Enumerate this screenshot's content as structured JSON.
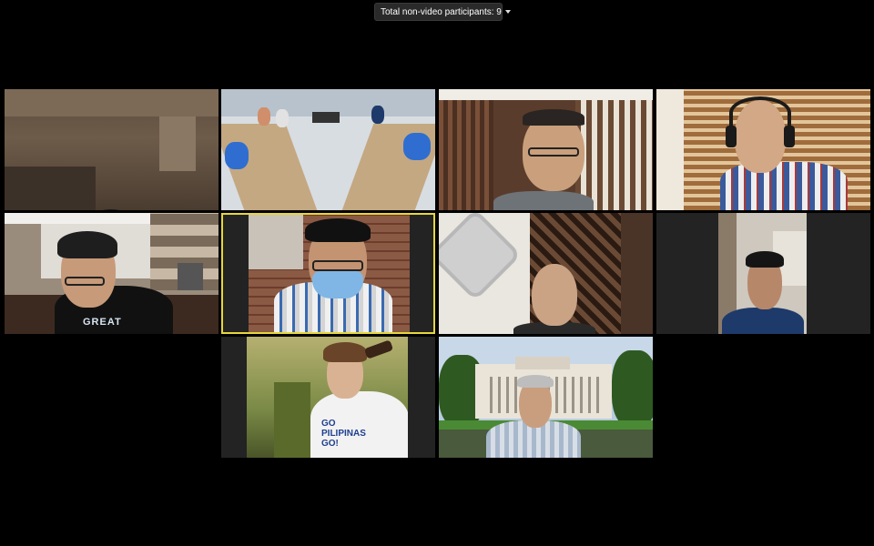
{
  "toolbar": {
    "participants_label": "Total non-video participants: 9"
  },
  "tiles": [
    {
      "id": "tile-1",
      "active": false,
      "shirt_text": ""
    },
    {
      "id": "tile-2",
      "active": false,
      "shirt_text": ""
    },
    {
      "id": "tile-3",
      "active": false,
      "shirt_text": ""
    },
    {
      "id": "tile-4",
      "active": false,
      "shirt_text": ""
    },
    {
      "id": "tile-5",
      "active": false,
      "shirt_text": "GREAT"
    },
    {
      "id": "tile-6",
      "active": true,
      "shirt_text": ""
    },
    {
      "id": "tile-7",
      "active": false,
      "shirt_text": ""
    },
    {
      "id": "tile-8",
      "active": false,
      "shirt_text": ""
    },
    {
      "id": "tile-9",
      "active": false,
      "shirt_text": "GO PILIPINAS GO!"
    },
    {
      "id": "tile-10",
      "active": false,
      "shirt_text": ""
    }
  ],
  "colors": {
    "background": "#000000",
    "active_speaker_border": "#e6d63c",
    "letterbox": "#232323"
  },
  "icons": {
    "dropdown": "chevron-down-icon"
  }
}
